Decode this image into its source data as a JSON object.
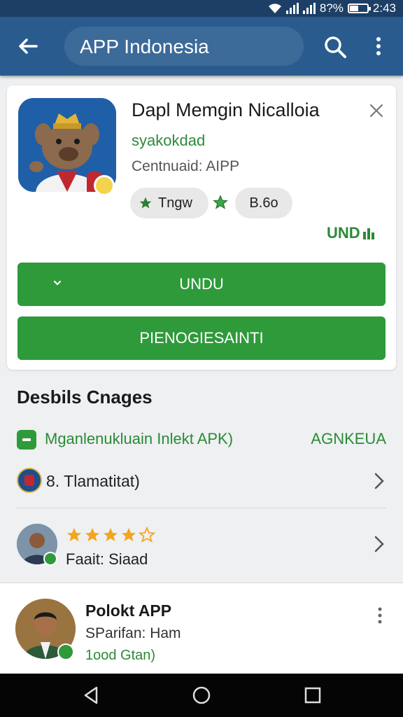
{
  "status": {
    "battery": "8?%",
    "time": "2:43"
  },
  "appbar": {
    "title": "APP Indonesia"
  },
  "app": {
    "title": "Dapl Memgin Nicalloia",
    "developer": "syakokdad",
    "category": "Centnuaid: AIPP",
    "chip_a": "Tngw",
    "chip_b": "B.6o",
    "und_label": "UND"
  },
  "buttons": {
    "install": "UNDU",
    "secondary": "PIENOGIESAINTI"
  },
  "details": {
    "title": "Desbils Cnages",
    "apk_row": {
      "label": "Mganlenukluain Inlekt APK)",
      "right": "AGNKEUA"
    },
    "rating_row": {
      "label": "8. Tlamatitat)"
    },
    "review_row": {
      "label": "Faait: Siaad",
      "stars": 4.5
    }
  },
  "review": {
    "title": "Polokt APP",
    "subtitle": "SParifan: Ham",
    "date": "1ood Gtan)"
  },
  "colors": {
    "accent": "#2e9a3a",
    "appbar": "#2a5b8e",
    "statusbar": "#1d3f66",
    "star": "#f4a51c"
  },
  "icons": [
    "back-arrow-icon",
    "search-icon",
    "more-vert-icon",
    "close-icon",
    "chevron-right-icon",
    "star-icon",
    "back-triangle-icon",
    "home-circle-icon",
    "recents-square-icon"
  ]
}
